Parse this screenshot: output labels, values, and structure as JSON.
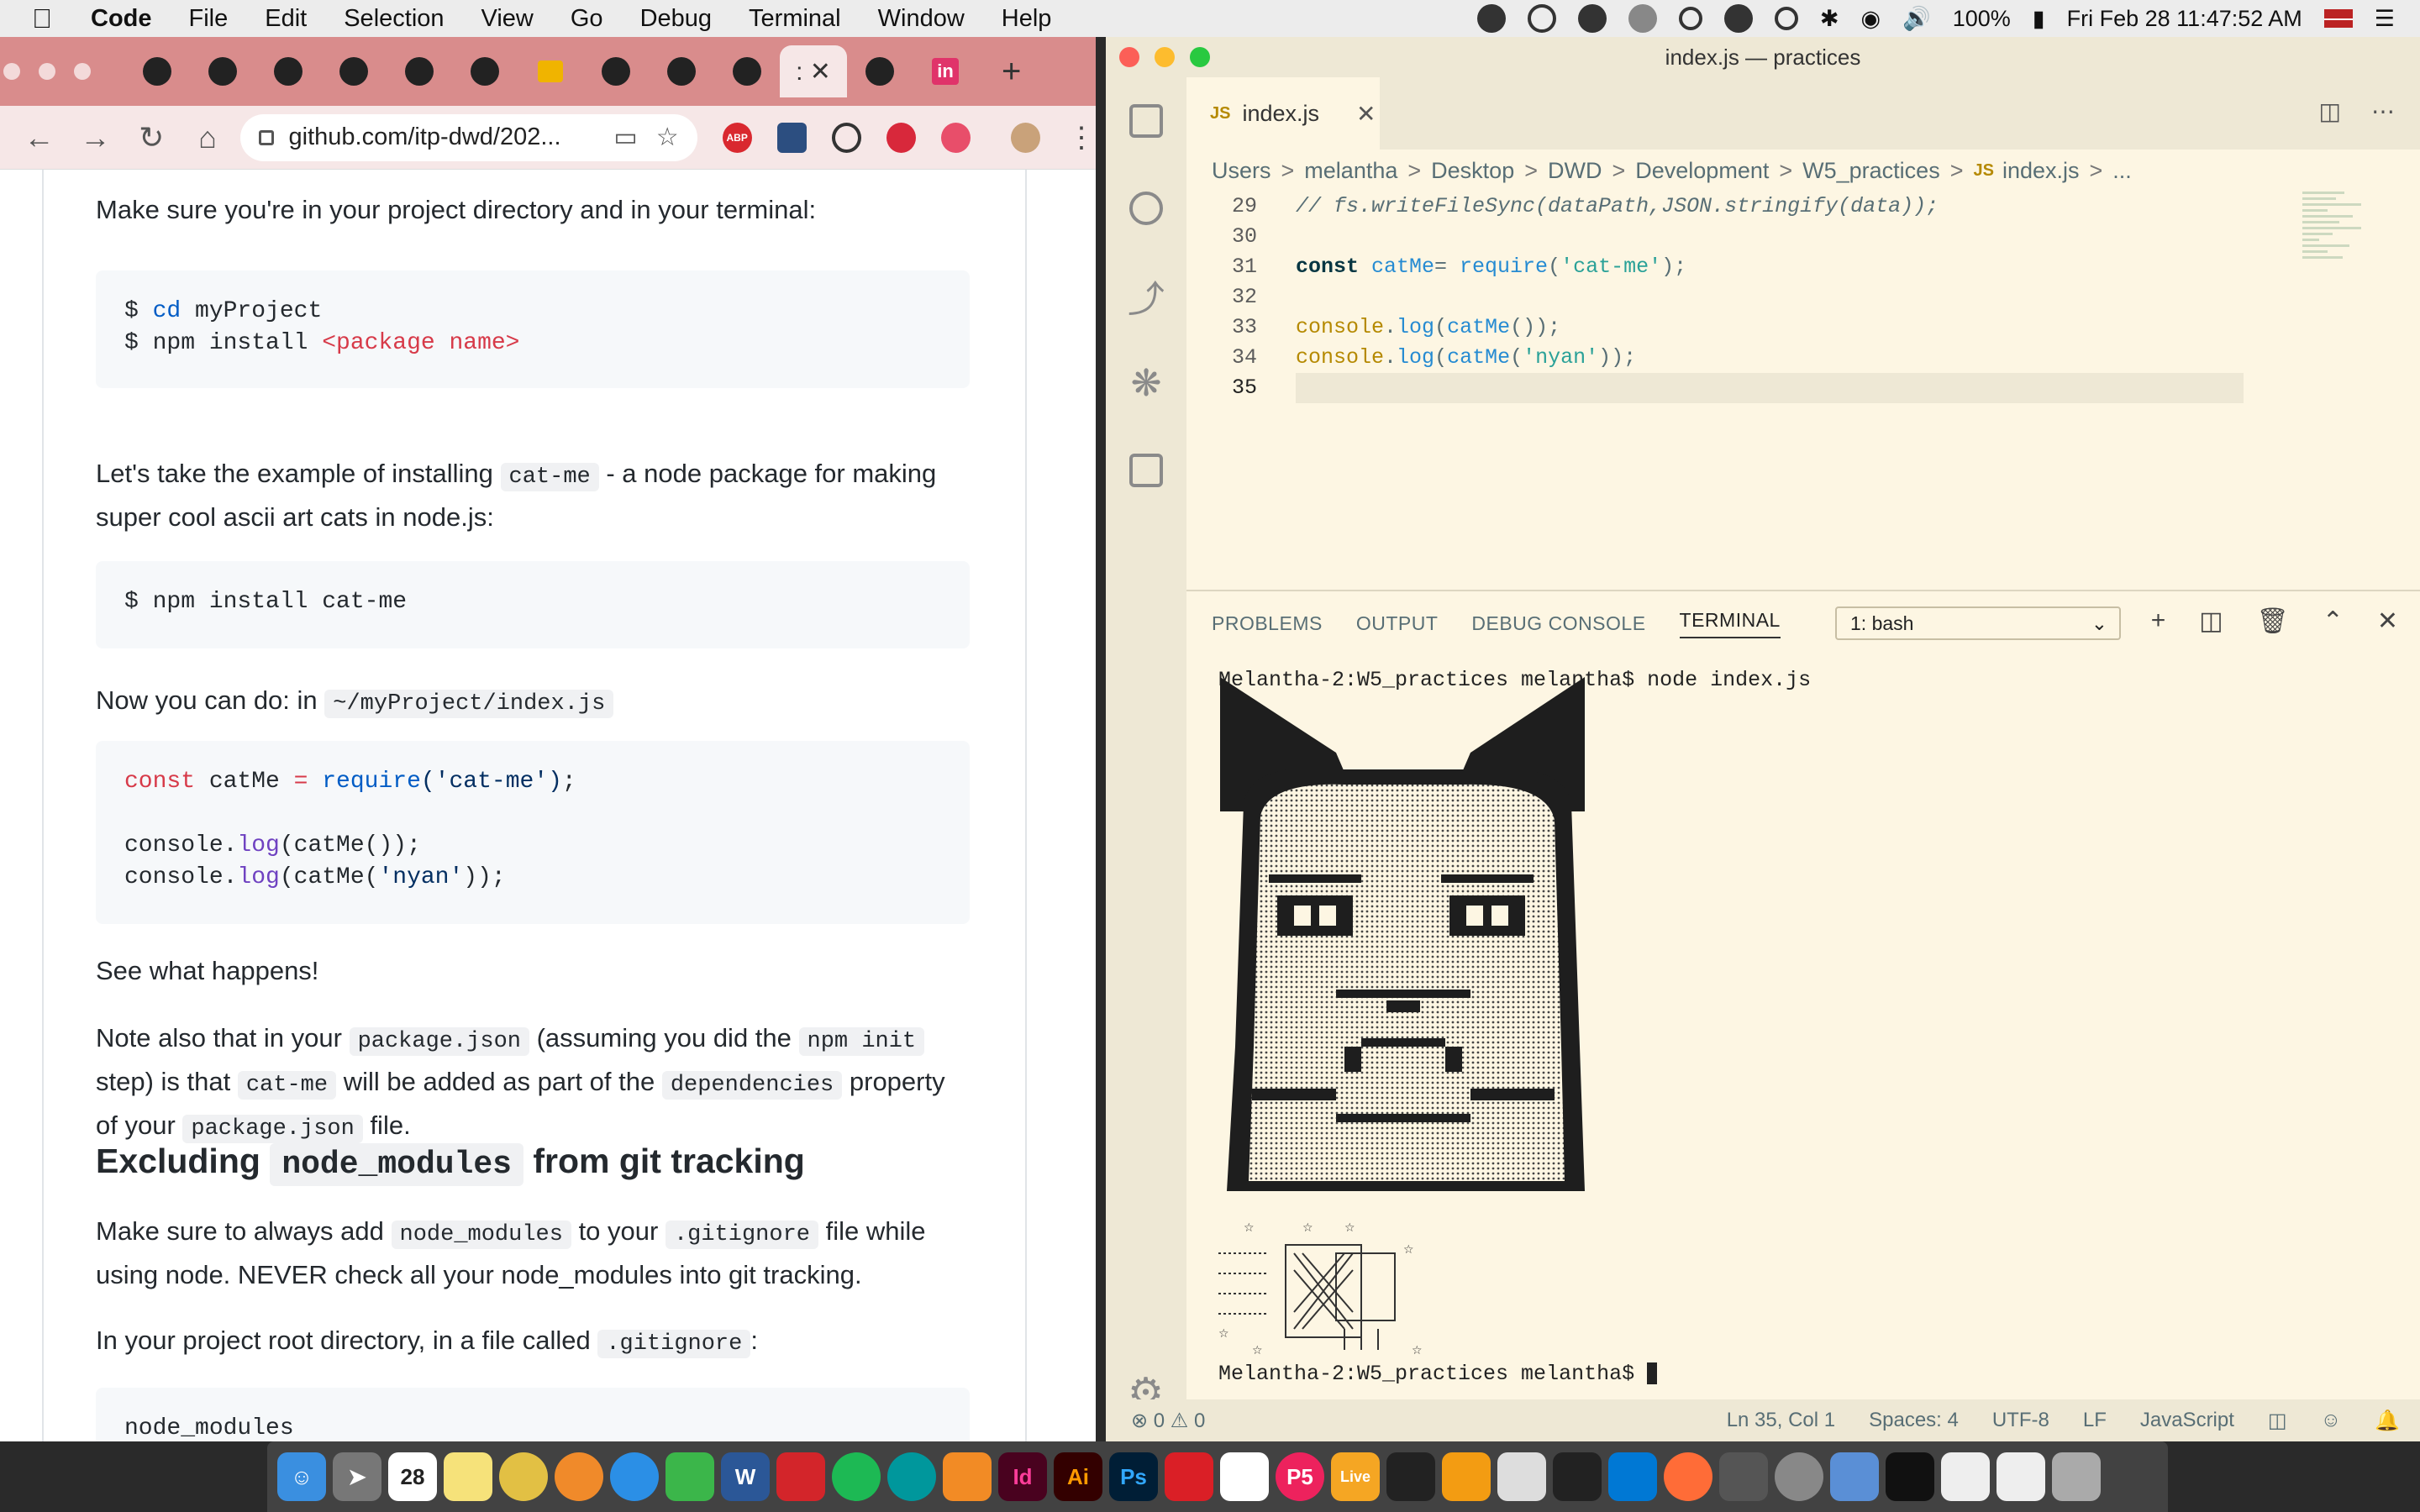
{
  "menubar": {
    "items": [
      "Code",
      "File",
      "Edit",
      "Selection",
      "View",
      "Go",
      "Debug",
      "Terminal",
      "Window",
      "Help"
    ],
    "battery": "100%",
    "datetime": "Fri Feb 28  11:47:52 AM"
  },
  "chrome": {
    "url": "github.com/itp-dwd/202...",
    "active_tab_glyph": ": ✕",
    "invision_label": "in",
    "abp_label": "ABP"
  },
  "page": {
    "p1": "Make sure you're in your project directory and in your terminal:",
    "code1": {
      "l1_prompt": "$ ",
      "l1_cmd": "cd",
      "l1_arg": " myProject",
      "l2_prompt": "$ npm install ",
      "l2_arg": "<package name>"
    },
    "p2_a": "Let's take the example of installing ",
    "p2_code": "cat-me",
    "p2_b": " - a node package for making super cool ascii art cats in node.js:",
    "code2": "$ npm install cat-me",
    "p3_a": "Now you can do: in ",
    "p3_code": "~/myProject/index.js",
    "code3": {
      "kw": "const",
      "var": " catMe ",
      "eq": "=",
      "fn": " require",
      "str": "('cat-me')",
      "end": ";",
      "l3a": "console.",
      "l3b": "log",
      "l3c": "(catMe());",
      "l4a": "console.",
      "l4b": "log",
      "l4c": "(catMe(",
      "l4d": "'nyan'",
      "l4e": "));"
    },
    "p4": "See what happens!",
    "p5_a": "Note also that in your ",
    "p5_c1": "package.json",
    "p5_b": " (assuming you did the ",
    "p5_c2": "npm init",
    "p5_c": " step) is that ",
    "p5_c3": "cat-me",
    "p5_d": " will be added as part of the ",
    "p5_c4": "dependencies",
    "p5_e": " property of your ",
    "p5_c5": "package.json",
    "p5_f": " file.",
    "h2_a": "Excluding ",
    "h2_code": "node_modules",
    "h2_b": " from git tracking",
    "p6_a": "Make sure to always add ",
    "p6_c1": "node_modules",
    "p6_b": " to your ",
    "p6_c2": ".gitignore",
    "p6_c": " file while using node. NEVER check all your node_modules into git tracking.",
    "p7_a": "In your project root directory, in a file called ",
    "p7_code": ".gitignore",
    "p7_b": ":",
    "code4": "node_modules"
  },
  "vscode": {
    "title": "index.js — practices",
    "tab_label": "index.js",
    "tab_js": "JS",
    "breadcrumb": [
      "Users",
      "melantha",
      "Desktop",
      "DWD",
      "Development",
      "W5_practices"
    ],
    "breadcrumb_file": "index.js",
    "breadcrumb_tail": "...",
    "code_lines": [
      {
        "n": "29",
        "t": "// fs.writeFileSync(dataPath,JSON.stringify(data));"
      },
      {
        "n": "30",
        "t": ""
      },
      {
        "n": "31",
        "kw": "const ",
        "v": "catMe",
        "op": "= ",
        "fn": "require",
        "s1": "(",
        "s": "'cat-me'",
        "s2": ");"
      },
      {
        "n": "32",
        "t": ""
      },
      {
        "n": "33",
        "c": "console",
        "d": ".",
        "f": "log",
        "r": "(",
        "f2": "catMe",
        "r2": "());"
      },
      {
        "n": "34",
        "c": "console",
        "d": ".",
        "f": "log",
        "r": "(",
        "f2": "catMe",
        "r2": "(",
        "s": "'nyan'",
        "r3": "));"
      },
      {
        "n": "35",
        "t": ""
      }
    ],
    "panel_tabs": [
      "PROBLEMS",
      "OUTPUT",
      "DEBUG CONSOLE",
      "TERMINAL"
    ],
    "terminal_select": "1: bash",
    "term_cmd_line": "Melantha-2:W5_practices melantha$ node index.js",
    "term_prompt": "Melantha-2:W5_practices melantha$ ",
    "status": {
      "problems": "⊗ 0 ⚠ 0",
      "position": "Ln 35, Col 1",
      "spaces": "Spaces: 4",
      "encoding": "UTF-8",
      "eol": "LF",
      "language": "JavaScript"
    }
  },
  "dock": {
    "items": [
      "Finder",
      "Launchpad",
      "Calendar",
      "Notes",
      "Chrome",
      "Firefox",
      "Safari",
      "WeChat",
      "Word",
      "Acrobat",
      "Spotify",
      "Arduino",
      "Sublime",
      "InDesign",
      "Illustrator",
      "Photoshop",
      "Creative Cloud",
      "Slack",
      "p5",
      "Live",
      "Terminal2",
      "Books",
      "Preview",
      "Figma",
      "VS Code",
      "Postman",
      "Unity",
      "System Prefs",
      "Photos",
      "Terminal",
      "Docs1",
      "Docs2",
      "Trash"
    ],
    "labels": {
      "id": "Id",
      "ai": "Ai",
      "ps": "Ps",
      "p5": "P5",
      "live": "Live",
      "w": "W",
      "cal": "28"
    }
  }
}
